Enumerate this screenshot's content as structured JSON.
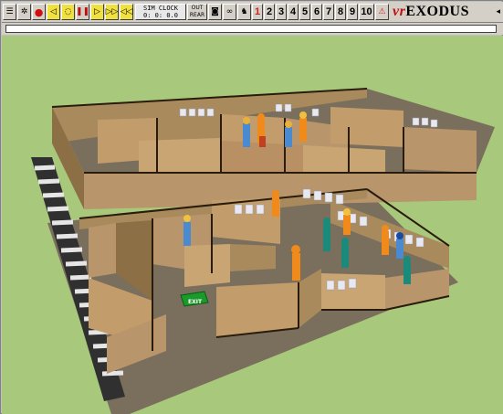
{
  "app": {
    "brand_prefix": "vr",
    "brand_name": "EXODUS"
  },
  "toolbar": {
    "sim_clock_label": "SIM CLOCK",
    "sim_clock_value": "0: 0: 0.0",
    "out_label": "OUT",
    "rear_label": "REAR",
    "floors": [
      "1",
      "2",
      "3",
      "4",
      "5",
      "6",
      "7",
      "8",
      "9",
      "10"
    ],
    "active_floor": "1"
  },
  "scene": {
    "exit_sign": "EXIT"
  }
}
